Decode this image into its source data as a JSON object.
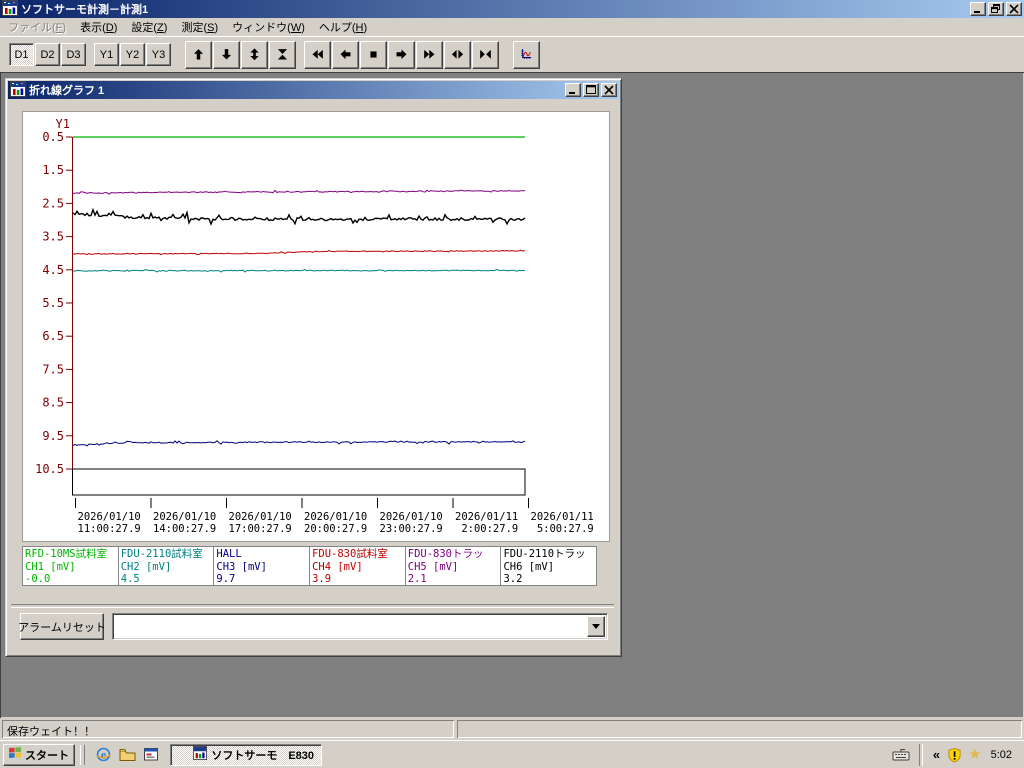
{
  "window": {
    "title": "ソフトサーモ計測－計測1"
  },
  "menu": {
    "items": [
      {
        "label": "ファイル(F)",
        "disabled": true
      },
      {
        "label": "表示(D)",
        "disabled": false
      },
      {
        "label": "設定(Z)",
        "disabled": false
      },
      {
        "label": "測定(S)",
        "disabled": false
      },
      {
        "label": "ウィンドウ(W)",
        "disabled": false
      },
      {
        "label": "ヘルプ(H)",
        "disabled": false
      }
    ]
  },
  "toolbar": {
    "d_buttons": [
      {
        "label": "D1",
        "pressed": true
      },
      {
        "label": "D2",
        "pressed": false
      },
      {
        "label": "D3",
        "pressed": false
      }
    ],
    "y_buttons": [
      {
        "label": "Y1",
        "pressed": false
      },
      {
        "label": "Y2",
        "pressed": false
      },
      {
        "label": "Y3",
        "pressed": false
      }
    ],
    "nav_icons_1": [
      "up-arrow",
      "down-arrow",
      "expand-vertical",
      "collapse-vertical"
    ],
    "nav_icons_2": [
      "rewind",
      "step-back",
      "stop",
      "step-forward",
      "fast-forward",
      "expand-horizontal",
      "collapse-horizontal"
    ],
    "graph_button_icon": "graph-settings"
  },
  "graph_window": {
    "title": "折れ線グラフ 1"
  },
  "chart_data": {
    "type": "line",
    "title": "折れ線グラフ 1",
    "y_axis": {
      "label": "Y1",
      "min": 0.5,
      "max": 10.5,
      "tick_step": 1,
      "direction": "increasing-downward",
      "color": "#800000"
    },
    "x_ticks": [
      {
        "date": "2026/01/10",
        "time": "11:00:27.9"
      },
      {
        "date": "2026/01/10",
        "time": "14:00:27.9"
      },
      {
        "date": "2026/01/10",
        "time": "17:00:27.9"
      },
      {
        "date": "2026/01/10",
        "time": "20:00:27.9"
      },
      {
        "date": "2026/01/10",
        "time": "23:00:27.9"
      },
      {
        "date": "2026/01/11",
        "time": " 2:00:27.9"
      },
      {
        "date": "2026/01/11",
        "time": " 5:00:27.9"
      }
    ],
    "series": [
      {
        "name": "RFD-10MS試料室",
        "ch_label": "CH1 [mV]",
        "value": "-0.0",
        "color": "#00b400",
        "width": 1.2,
        "trace": {
          "points": [
            [
              0,
              0.5
            ],
            [
              1,
              0.5
            ]
          ],
          "noise": 0,
          "spike": 0
        }
      },
      {
        "name": "FDU-2110試料室",
        "ch_label": "CH2 [mV]",
        "value": "4.5",
        "color": "#008080",
        "width": 1,
        "trace": {
          "points": [
            [
              0,
              4.53
            ],
            [
              1,
              4.52
            ]
          ],
          "noise": 0.013,
          "spike": 0.03
        }
      },
      {
        "name": "HALL",
        "ch_label": "CH3 [mV]",
        "value": "9.7",
        "color": "#000080",
        "width": 1,
        "trace": {
          "points": [
            [
              0,
              9.78
            ],
            [
              0.12,
              9.71
            ],
            [
              0.5,
              9.69
            ],
            [
              1,
              9.68
            ]
          ],
          "noise": 0.016,
          "spike": 0.05
        }
      },
      {
        "name": "FDU-830試料室",
        "ch_label": "CH4 [mV]",
        "value": "3.9",
        "color": "#c00000",
        "width": 1,
        "trace": {
          "points": [
            [
              0,
              4.02
            ],
            [
              0.42,
              4.01
            ],
            [
              0.52,
              3.95
            ],
            [
              1,
              3.93
            ]
          ],
          "noise": 0.012,
          "spike": 0.02
        }
      },
      {
        "name": "FDU-830トラッ",
        "ch_label": "CH5 [mV]",
        "value": "2.1",
        "color": "#800080",
        "width": 1,
        "trace": {
          "points": [
            [
              0,
              2.19
            ],
            [
              0.35,
              2.16
            ],
            [
              1,
              2.12
            ]
          ],
          "noise": 0.015,
          "spike": 0.035
        }
      },
      {
        "name": "FDU-2110トラッ",
        "ch_label": "CH6 [mV]",
        "value": "3.2",
        "color": "#000000",
        "width": 1.4,
        "trace": {
          "points": [
            [
              0,
              2.8
            ],
            [
              0.05,
              2.85
            ],
            [
              0.15,
              2.93
            ],
            [
              0.3,
              2.97
            ],
            [
              0.6,
              2.98
            ],
            [
              1,
              2.97
            ]
          ],
          "noise": 0.04,
          "spike": 0.16
        }
      }
    ]
  },
  "alarm": {
    "reset_label": "アラームリセット",
    "combo_value": ""
  },
  "statusbar": {
    "message": "保存ウェイト！！"
  },
  "taskbar": {
    "start_label": "スタート",
    "quick_launch_icons": [
      "internet-explorer-icon",
      "folder-icon",
      "window-icon"
    ],
    "task_label": "ソフトサーモ　E830",
    "tray": {
      "chevrons": "«",
      "icons": [
        "keyboard-icon",
        "security-shield-icon",
        "star-icon"
      ],
      "time": "5:02"
    }
  }
}
